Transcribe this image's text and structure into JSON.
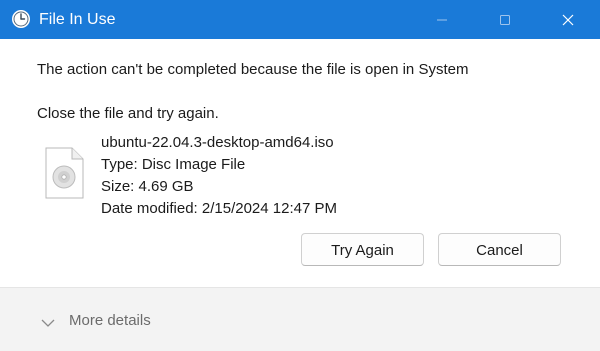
{
  "window": {
    "title": "File In Use",
    "accent_color": "#1a7ad8"
  },
  "title_icon": "clock-icon",
  "controls": {
    "minimize_icon": "minimize-icon",
    "maximize_icon": "maximize-icon",
    "close_icon": "close-icon"
  },
  "message": {
    "line1": "The action can't be completed because the file is open in System",
    "line2": "Close the file and try again."
  },
  "file": {
    "icon": "disc-image-file-icon",
    "name": "ubuntu-22.04.3-desktop-amd64.iso",
    "type": "Type: Disc Image File",
    "size": "Size: 4.69 GB",
    "date_modified": "Date modified: 2/15/2024 12:47 PM"
  },
  "buttons": {
    "try_again": "Try Again",
    "cancel": "Cancel"
  },
  "footer": {
    "more_details": "More details",
    "chevron_icon": "chevron-down-icon"
  }
}
